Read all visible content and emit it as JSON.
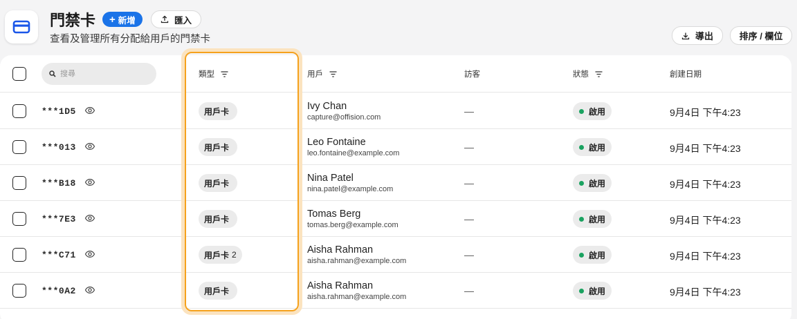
{
  "header": {
    "title": "門禁卡",
    "subtitle": "查看及管理所有分配給用戶的門禁卡",
    "new_label": "新增",
    "import_label": "匯入",
    "export_label": "導出",
    "sort_label": "排序 / 欄位",
    "accent_color": "#1a73e8"
  },
  "table": {
    "search_placeholder": "搜尋",
    "columns": [
      "類型",
      "用戶",
      "訪客",
      "狀態",
      "創建日期"
    ],
    "highlight_color": "#f5a11c",
    "rows": [
      {
        "id": "***1D5",
        "type": "用戶卡",
        "type_num": "",
        "name": "Ivy Chan",
        "email": "capture@offision.com",
        "visitor": "—",
        "status": "啟用",
        "date": "9月4日 下午4:23"
      },
      {
        "id": "***013",
        "type": "用戶卡",
        "type_num": "",
        "name": "Leo Fontaine",
        "email": "leo.fontaine@example.com",
        "visitor": "—",
        "status": "啟用",
        "date": "9月4日 下午4:23"
      },
      {
        "id": "***B18",
        "type": "用戶卡",
        "type_num": "",
        "name": "Nina Patel",
        "email": "nina.patel@example.com",
        "visitor": "—",
        "status": "啟用",
        "date": "9月4日 下午4:23"
      },
      {
        "id": "***7E3",
        "type": "用戶卡",
        "type_num": "",
        "name": "Tomas Berg",
        "email": "tomas.berg@example.com",
        "visitor": "—",
        "status": "啟用",
        "date": "9月4日 下午4:23"
      },
      {
        "id": "***C71",
        "type": "用戶卡",
        "type_num": "2",
        "name": "Aisha Rahman",
        "email": "aisha.rahman@example.com",
        "visitor": "—",
        "status": "啟用",
        "date": "9月4日 下午4:23"
      },
      {
        "id": "***0A2",
        "type": "用戶卡",
        "type_num": "",
        "name": "Aisha Rahman",
        "email": "aisha.rahman@example.com",
        "visitor": "—",
        "status": "啟用",
        "date": "9月4日 下午4:23"
      }
    ]
  }
}
